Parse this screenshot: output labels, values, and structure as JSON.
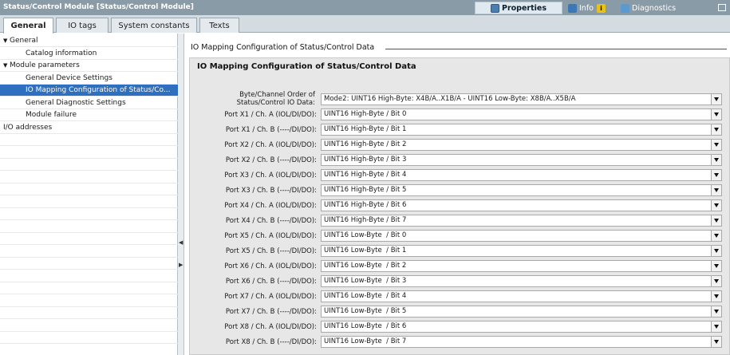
{
  "window": {
    "title": "Status/Control Module [Status/Control Module]",
    "properties_tab": "Properties",
    "info_tab": "Info",
    "diagnostics_tab": "Diagnostics"
  },
  "tabs": [
    "General",
    "IO tags",
    "System constants",
    "Texts"
  ],
  "tree": [
    {
      "label": "General",
      "indent": 0,
      "expanded": true,
      "selected": false
    },
    {
      "label": "Catalog information",
      "indent": 1,
      "selected": false
    },
    {
      "label": "Module parameters",
      "indent": 0,
      "expanded": true,
      "selected": false
    },
    {
      "label": "General Device Settings",
      "indent": 1,
      "selected": false
    },
    {
      "label": "IO Mapping Configuration of Status/Co...",
      "indent": 1,
      "selected": true
    },
    {
      "label": "General Diagnostic Settings",
      "indent": 1,
      "selected": false
    },
    {
      "label": "Module failure",
      "indent": 1,
      "selected": false
    },
    {
      "label": "I/O addresses",
      "indent": 0,
      "selected": false
    }
  ],
  "content": {
    "breadcrumb": "IO Mapping Configuration of Status/Control Data",
    "section_title": "IO Mapping Configuration of Status/Control Data",
    "byte_order": {
      "label_line1": "Byte/Channel Order of",
      "label_line2": "Status/Control IO Data:",
      "value": "Mode2: UINT16 High-Byte: X4B/A..X1B/A - UINT16 Low-Byte: X8B/A..X5B/A"
    },
    "ports": [
      {
        "label": "Port X1 / Ch. A (IOL/DI/DO):",
        "value": "UINT16 High-Byte / Bit 0"
      },
      {
        "label": "Port X1 / Ch. B (----/DI/DO):",
        "value": "UINT16 High-Byte / Bit 1"
      },
      {
        "label": "Port X2 / Ch. A (IOL/DI/DO):",
        "value": "UINT16 High-Byte / Bit 2"
      },
      {
        "label": "Port X2 / Ch. B (----/DI/DO):",
        "value": "UINT16 High-Byte / Bit 3"
      },
      {
        "label": "Port X3 / Ch. A (IOL/DI/DO):",
        "value": "UINT16 High-Byte / Bit 4"
      },
      {
        "label": "Port X3 / Ch. B (----/DI/DO):",
        "value": "UINT16 High-Byte / Bit 5"
      },
      {
        "label": "Port X4 / Ch. A (IOL/DI/DO):",
        "value": "UINT16 High-Byte / Bit 6"
      },
      {
        "label": "Port X4 / Ch. B (----/DI/DO):",
        "value": "UINT16 High-Byte / Bit 7"
      },
      {
        "label": "Port X5 / Ch. A (IOL/DI/DO):",
        "value": "UINT16 Low-Byte  / Bit 0"
      },
      {
        "label": "Port X5 / Ch. B (----/DI/DO):",
        "value": "UINT16 Low-Byte  / Bit 1"
      },
      {
        "label": "Port X6 / Ch. A (IOL/DI/DO):",
        "value": "UINT16 Low-Byte  / Bit 2"
      },
      {
        "label": "Port X6 / Ch. B (----/DI/DO):",
        "value": "UINT16 Low-Byte  / Bit 3"
      },
      {
        "label": "Port X7 / Ch. A (IOL/DI/DO):",
        "value": "UINT16 Low-Byte  / Bit 4"
      },
      {
        "label": "Port X7 / Ch. B (----/DI/DO):",
        "value": "UINT16 Low-Byte  / Bit 5"
      },
      {
        "label": "Port X8 / Ch. A (IOL/DI/DO):",
        "value": "UINT16 Low-Byte  / Bit 6"
      },
      {
        "label": "Port X8 / Ch. B (----/DI/DO):",
        "value": "UINT16 Low-Byte  / Bit 7"
      }
    ]
  },
  "colors": {
    "titlebar": "#8a9ba8",
    "selection": "#2f6fbf",
    "section_bg": "#e7e7e7"
  }
}
